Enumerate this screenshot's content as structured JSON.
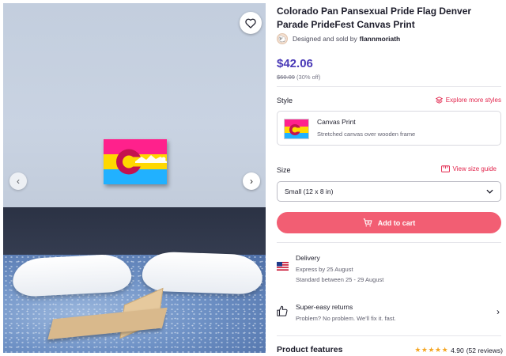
{
  "product": {
    "title": "Colorado Pan Pansexual Pride Flag Denver Parade PrideFest Canvas Print",
    "designer_prefix": "Designed and sold by",
    "designer_name": "flannmoriath",
    "price": "$42.06",
    "original_price": "$60.09",
    "discount": "(30% off)"
  },
  "style": {
    "label": "Style",
    "explore_link": "Explore more styles",
    "selected_name": "Canvas Print",
    "selected_desc": "Stretched canvas over wooden frame"
  },
  "size": {
    "label": "Size",
    "guide_link": "View size guide",
    "selected": "Small (12 x 8 in)"
  },
  "cart": {
    "label": "Add to cart"
  },
  "delivery": {
    "title": "Delivery",
    "express": "Express by 25 August",
    "standard": "Standard between 25 - 29 August"
  },
  "returns": {
    "title": "Super-easy returns",
    "subtitle": "Problem? No problem. We'll fix it. fast."
  },
  "features": {
    "title": "Product features",
    "rating": "4.90",
    "reviews": "(52 reviews)",
    "stars": 5
  },
  "icons": {
    "favorite": "heart-icon",
    "prev": "chevron-left-icon",
    "next": "chevron-right-icon",
    "explore": "layers-icon",
    "size_guide": "ruler-icon",
    "select": "chevron-down-icon",
    "cart": "cart-plus-icon",
    "delivery": "us-flag-icon",
    "returns": "thumbs-up-icon"
  },
  "colors": {
    "price": "#4a3ab7",
    "accent": "#e2254c",
    "cart_button": "#f25e73",
    "flag_pink": "#ff218c",
    "flag_yellow": "#ffd800",
    "flag_blue": "#21b1ff",
    "stars": "#f5a623"
  }
}
